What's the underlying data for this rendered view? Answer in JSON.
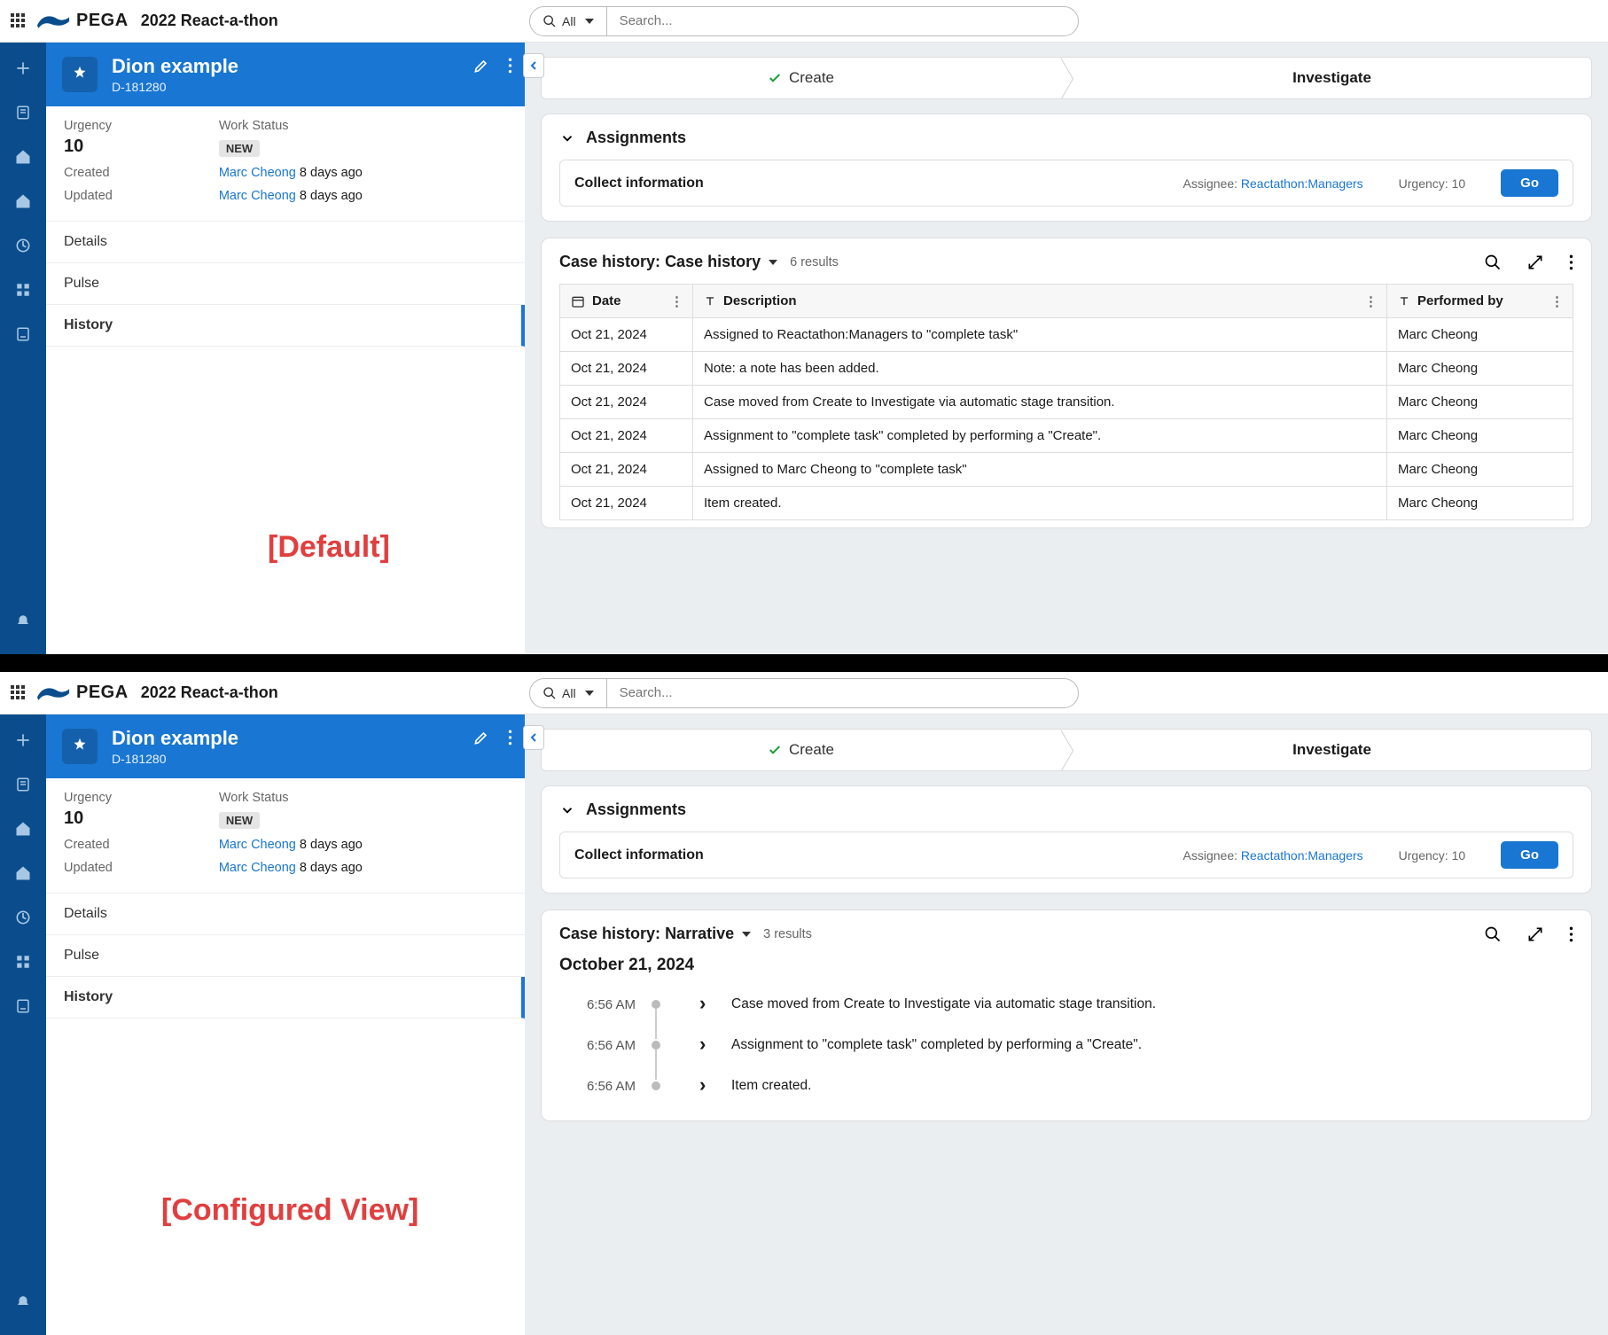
{
  "topbar": {
    "brand": "PEGA",
    "title": "2022 React-a-thon",
    "search_scope": "All",
    "search_placeholder": "Search..."
  },
  "case": {
    "title": "Dion example",
    "id": "D-181280"
  },
  "summary": {
    "urgency_label": "Urgency",
    "urgency_value": "10",
    "workstatus_label": "Work Status",
    "workstatus_value": "NEW",
    "created_label": "Created",
    "created_by": "Marc Cheong",
    "created_ago": "8 days ago",
    "updated_label": "Updated",
    "updated_by": "Marc Cheong",
    "updated_ago": "8 days ago"
  },
  "tabs": {
    "details": "Details",
    "pulse": "Pulse",
    "history": "History"
  },
  "overlay": {
    "default_label": "[Default]",
    "configured_label": "[Configured View]"
  },
  "stepper": {
    "create": "Create",
    "investigate": "Investigate"
  },
  "assignments": {
    "heading": "Assignments",
    "task": "Collect information",
    "assignee_label": "Assignee:",
    "assignee_value": "Reactathon:Managers",
    "urgency_label": "Urgency:",
    "urgency_value": "10",
    "go": "Go"
  },
  "history_default": {
    "title_prefix": "Case history:",
    "title_view": "Case history",
    "results": "6 results",
    "columns": {
      "date": "Date",
      "description": "Description",
      "performed_by": "Performed by"
    },
    "rows": [
      {
        "date": "Oct 21, 2024",
        "desc": "Assigned to Reactathon:Managers to \"complete task\"",
        "by": "Marc Cheong"
      },
      {
        "date": "Oct 21, 2024",
        "desc": "Note: a note has been added.",
        "by": "Marc Cheong"
      },
      {
        "date": "Oct 21, 2024",
        "desc": "Case moved from Create to Investigate via automatic stage transition.",
        "by": "Marc Cheong"
      },
      {
        "date": "Oct 21, 2024",
        "desc": "Assignment to \"complete task\" completed by performing a \"Create\".",
        "by": "Marc Cheong"
      },
      {
        "date": "Oct 21, 2024",
        "desc": "Assigned to Marc Cheong to \"complete task\"",
        "by": "Marc Cheong"
      },
      {
        "date": "Oct 21, 2024",
        "desc": "Item created.",
        "by": "Marc Cheong"
      }
    ]
  },
  "history_narrative": {
    "title_prefix": "Case history:",
    "title_view": "Narrative",
    "results": "3 results",
    "date_heading": "October 21, 2024",
    "rows": [
      {
        "time": "6:56 AM",
        "text": "Case moved from Create to Investigate via automatic stage transition."
      },
      {
        "time": "6:56 AM",
        "text": "Assignment to \"complete task\" completed by performing a \"Create\"."
      },
      {
        "time": "6:56 AM",
        "text": "Item created."
      }
    ]
  }
}
